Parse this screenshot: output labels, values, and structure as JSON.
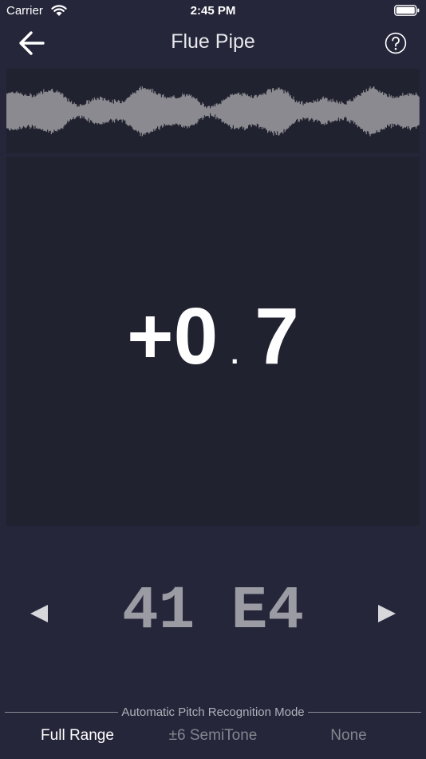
{
  "status_bar": {
    "carrier": "Carrier",
    "time": "2:45 PM"
  },
  "nav": {
    "title": "Flue Pipe",
    "back_icon": "back-arrow-icon",
    "help_icon": "question-circle-icon"
  },
  "tuner": {
    "cents_sign": "+0",
    "cents_dot": ".",
    "cents_fraction": "7"
  },
  "note": {
    "text": "41 E4",
    "prev_icon": "left-triangle-icon",
    "next_icon": "right-triangle-icon"
  },
  "mode": {
    "label": "Automatic Pitch Recognition Mode",
    "options": [
      {
        "label": "Full Range",
        "selected": true
      },
      {
        "label": "±6 SemiTone",
        "selected": false
      },
      {
        "label": "None",
        "selected": false
      }
    ]
  },
  "colors": {
    "background": "#25263a",
    "panel": "#212230",
    "waveform": "#8a8a90",
    "selected_text": "#ffffff",
    "unselected_text": "#85858f"
  }
}
